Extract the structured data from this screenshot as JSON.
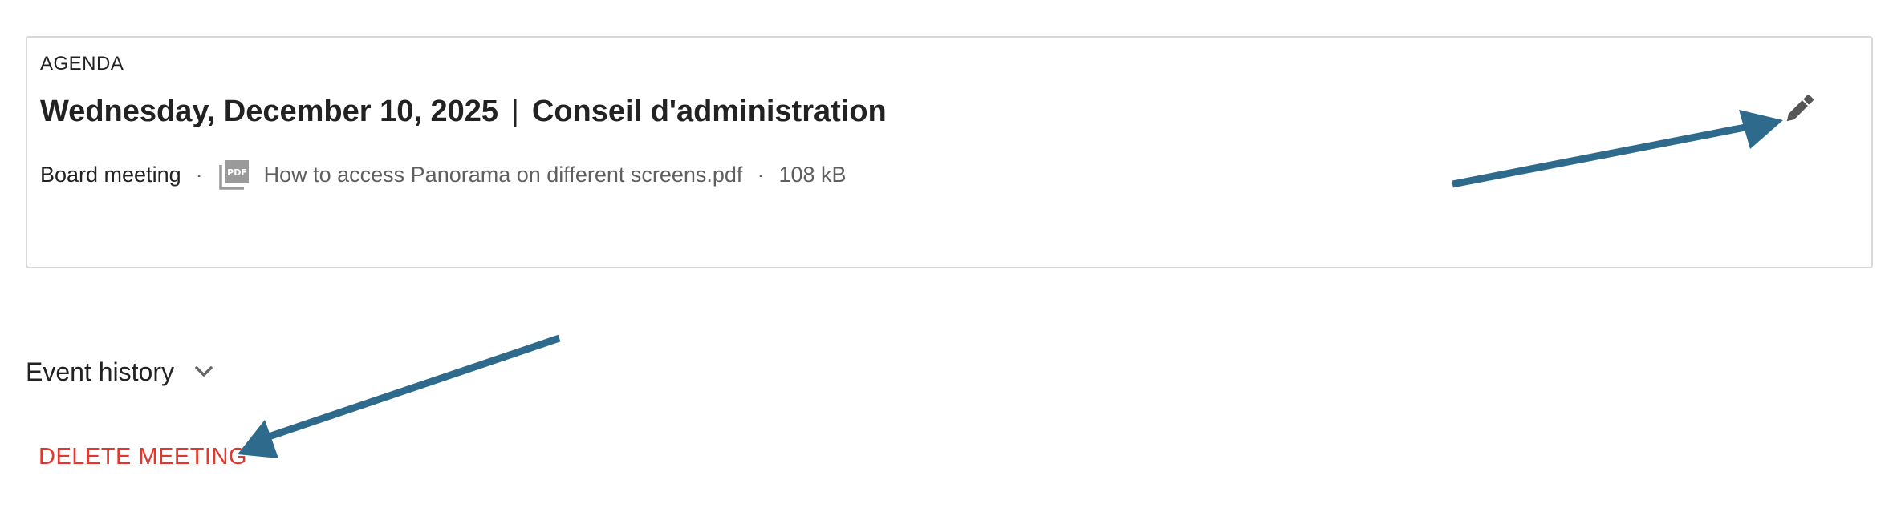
{
  "agenda": {
    "section_label": "AGENDA",
    "date": "Wednesday, December 10, 2025",
    "separator": "|",
    "committee": "Conseil d'administration",
    "meeting_type": "Board meeting",
    "dot": "·",
    "attachment": {
      "icon": "pdf-file-icon",
      "icon_text": "PDF",
      "file_name": "How to access Panorama on different screens.pdf",
      "file_size": "108 kB"
    },
    "edit_icon": "pencil-icon"
  },
  "event_history": {
    "label": "Event history",
    "icon": "chevron-down-icon"
  },
  "actions": {
    "delete_label": "DELETE MEETING"
  },
  "colors": {
    "delete": "#e2372c",
    "annotation_arrow": "#2e6a8c",
    "card_border": "#d8d8d8"
  }
}
